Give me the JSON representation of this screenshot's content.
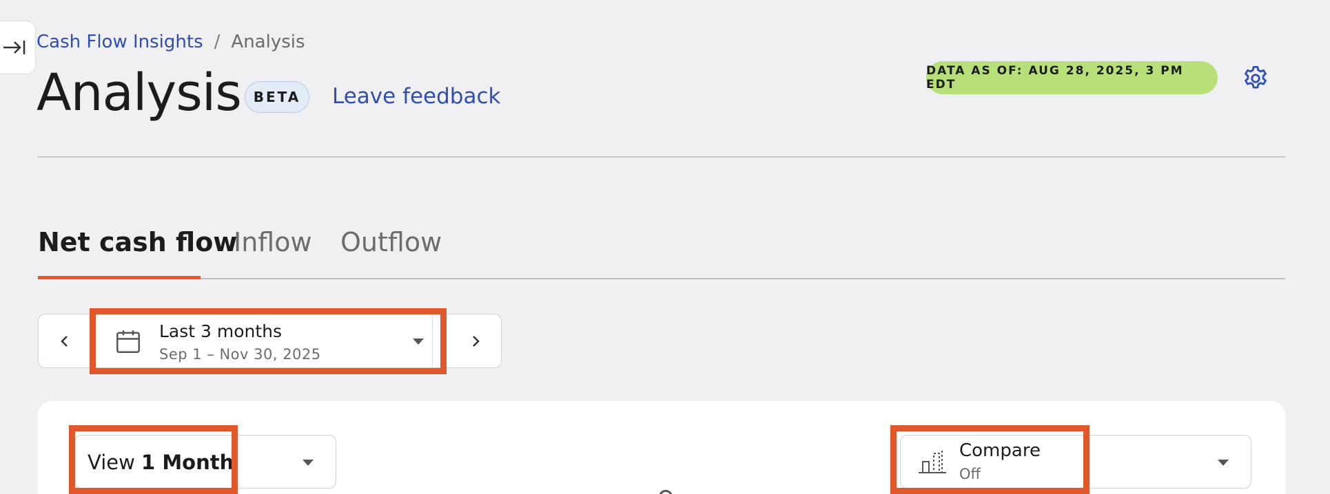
{
  "breadcrumb": {
    "parent": "Cash Flow Insights",
    "separator": "/",
    "current": "Analysis"
  },
  "header": {
    "title": "Analysis",
    "badge": "BETA",
    "feedback_link": "Leave feedback",
    "data_as_of": "DATA AS OF: AUG 28, 2025, 3 PM EDT"
  },
  "tabs": [
    {
      "label": "Net cash flow",
      "active": true
    },
    {
      "label": "Inflow",
      "active": false
    },
    {
      "label": "Outflow",
      "active": false
    }
  ],
  "date_filter": {
    "label": "Last 3 months",
    "range": "Sep 1 – Nov 30, 2025"
  },
  "view_select": {
    "prefix": "View",
    "value": "1 Month"
  },
  "compare_select": {
    "label": "Compare",
    "value": "Off"
  },
  "colors": {
    "accent_link": "#2e4fb0",
    "active_tab_underline": "#e8582b",
    "data_pill": "#b8e07a",
    "highlight_box": "#e0572b",
    "background": "#f0f0f2"
  },
  "icons": {
    "collapse": "collapse-sidebar-icon",
    "settings": "gear-icon",
    "calendar": "calendar-icon",
    "prev": "chevron-left-icon",
    "next": "chevron-right-icon",
    "compare": "compare-chart-icon",
    "dropdown": "caret-down-icon"
  }
}
